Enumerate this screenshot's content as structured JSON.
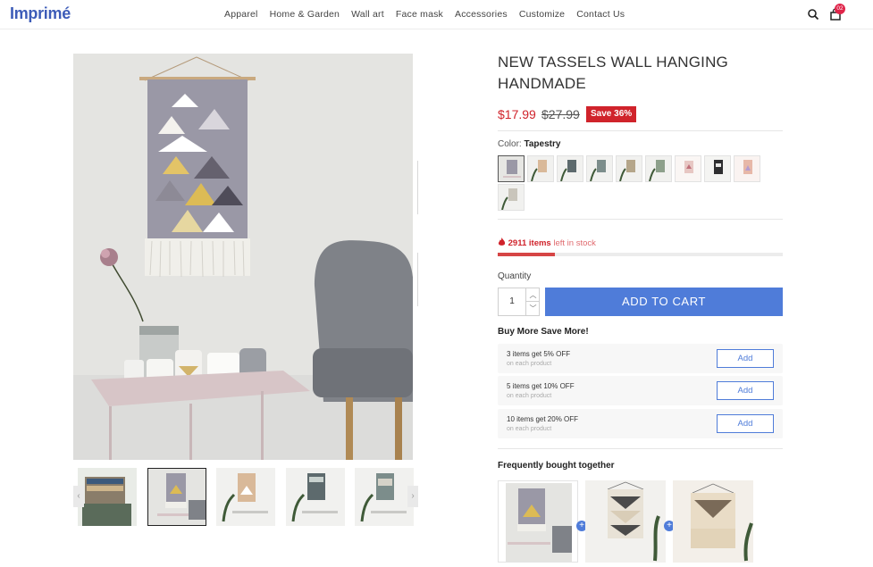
{
  "header": {
    "logo": "Imprimé",
    "nav": [
      "Apparel",
      "Home & Garden",
      "Wall art",
      "Face mask",
      "Accessories",
      "Customize",
      "Contact Us"
    ],
    "cart_count": "02",
    "icons": {
      "search": "search-icon",
      "cart": "shopping-bag-icon"
    }
  },
  "product": {
    "title": "NEW TASSELS WALL HANGING HANDMADE",
    "price": "$17.99",
    "old_price": "$27.99",
    "save_badge": "Save 36%",
    "color_label": "Color:",
    "color_value": "Tapestry",
    "swatch_count": 10,
    "selected_swatch": 0
  },
  "stock": {
    "count": "2911 items",
    "suffix": " left in stock",
    "level_fraction": 0.2
  },
  "quantity": {
    "label": "Quantity",
    "value": "1",
    "add_to_cart": "ADD TO CART"
  },
  "bulk": {
    "title": "Buy More Save More!",
    "offers": [
      {
        "title": "3 items get 5% OFF",
        "sub": "on each product",
        "button": "Add"
      },
      {
        "title": "5 items get 10% OFF",
        "sub": "on each product",
        "button": "Add"
      },
      {
        "title": "10 items get 20% OFF",
        "sub": "on each product",
        "button": "Add"
      }
    ]
  },
  "fbt": {
    "title": "Frequently bought together",
    "plus": "+"
  },
  "colors": {
    "brand": "#3d5cb8",
    "accent": "#4f7cd9",
    "sale": "#d0232b"
  }
}
